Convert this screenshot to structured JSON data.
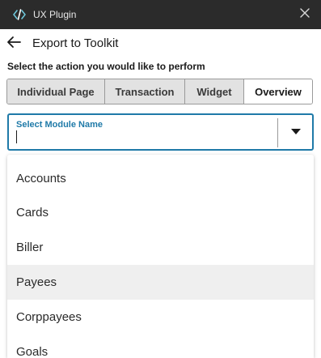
{
  "window": {
    "title": "UX Plugin",
    "icons": {
      "logo": "code-bracket-icon",
      "close": "close-icon"
    }
  },
  "header": {
    "title": "Export to Toolkit",
    "back_icon": "arrow-left-icon"
  },
  "prompt": "Select the action you would like to perform",
  "tabs": [
    {
      "label": "Individual Page",
      "active": false
    },
    {
      "label": "Transaction",
      "active": false
    },
    {
      "label": "Widget",
      "active": false
    },
    {
      "label": "Overview",
      "active": true
    }
  ],
  "module_select": {
    "label": "Select Module Name",
    "value": "",
    "toggle_icon": "caret-down-icon"
  },
  "options": [
    {
      "label": "Accounts"
    },
    {
      "label": "Cards"
    },
    {
      "label": "Biller"
    },
    {
      "label": "Payees",
      "highlighted": true
    },
    {
      "label": "Corppayees"
    },
    {
      "label": "Goals"
    }
  ],
  "colors": {
    "titlebar": "#2b2b2b",
    "accent": "#1f7aa8",
    "tab_inactive": "#e2e2e2",
    "option_highlight": "#efefef"
  }
}
